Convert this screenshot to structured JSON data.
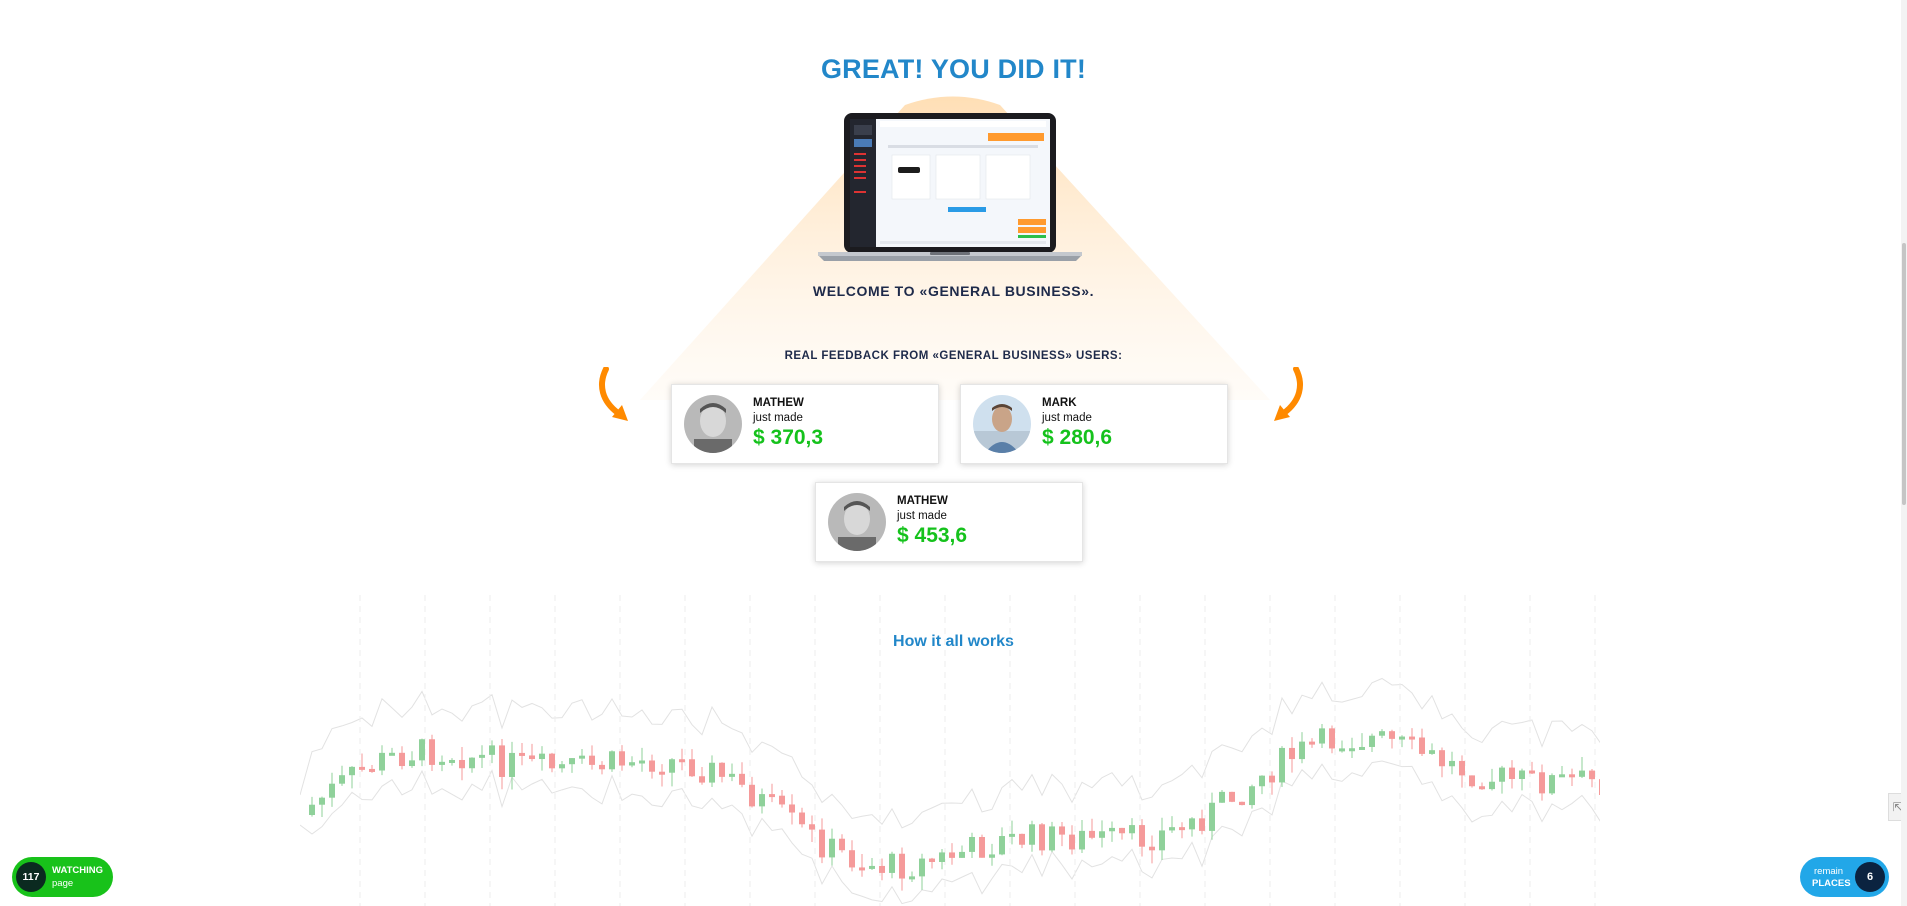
{
  "hero": {
    "title": "GREAT! YOU DID IT!",
    "welcome": "WELCOME TO «GENERAL BUSINESS»."
  },
  "feedback": {
    "title": "REAL FEEDBACK FROM «GENERAL BUSINESS» USERS:",
    "cards": [
      {
        "name": "MATHEW",
        "made_label": "just made",
        "amount": "$ 370,3"
      },
      {
        "name": "MARK",
        "made_label": "just made",
        "amount": "$ 280,6"
      },
      {
        "name": "MATHEW",
        "made_label": "just made",
        "amount": "$ 453,6"
      }
    ]
  },
  "how_it_works": {
    "title": "How it all works"
  },
  "widgets": {
    "watching": {
      "count": "117",
      "line1": "WATCHING",
      "line2": "page"
    },
    "places": {
      "line1": "remain",
      "line2": "PLACES",
      "count": "6"
    }
  },
  "colors": {
    "accent_blue": "#2287c9",
    "amount_green": "#15c21c",
    "arrow_orange": "#ff8a00",
    "candle_up": "#8fd19a",
    "candle_down": "#f59a9a"
  },
  "icons": {
    "left_arrow": "curved-arrow-down-right-icon",
    "right_arrow": "curved-arrow-down-left-icon",
    "side_tab": "collapse-icon"
  }
}
